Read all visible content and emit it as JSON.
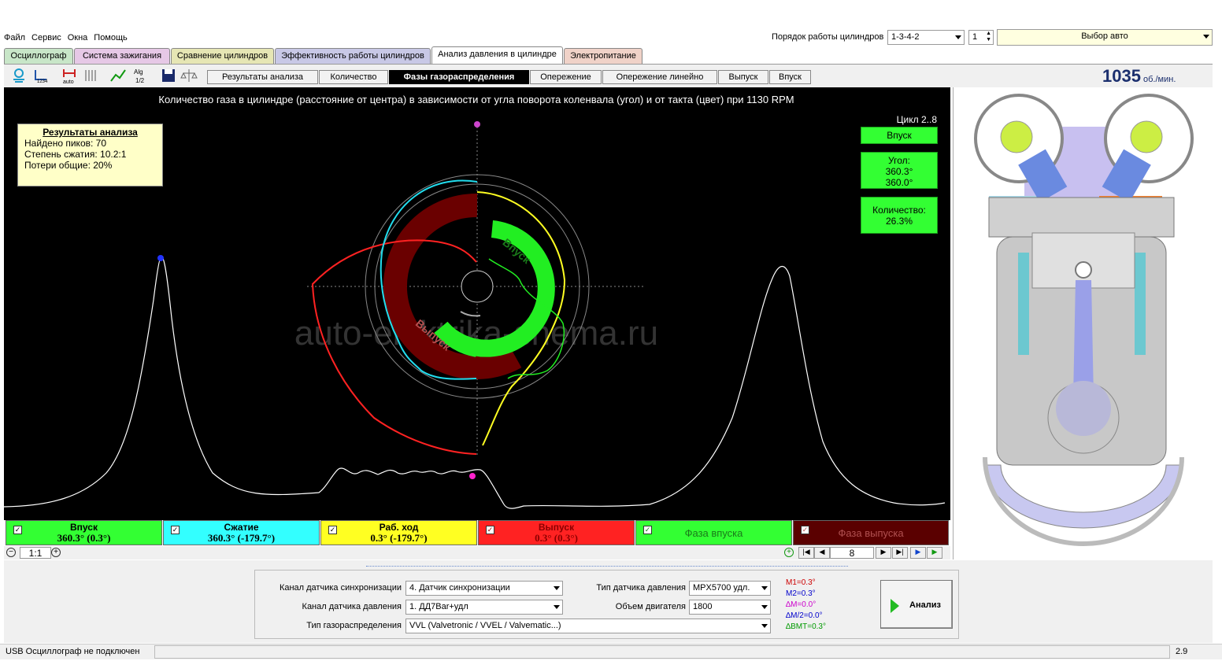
{
  "menu": [
    "Файл",
    "Сервис",
    "Окна",
    "Помощь"
  ],
  "cyl_order": {
    "label": "Порядок работы цилиндров",
    "value": "1-3-4-2",
    "cyl": "1",
    "car": "Выбор авто"
  },
  "tabs": [
    "Осциллограф",
    "Система зажигания",
    "Сравнение цилиндров",
    "Эффективность работы цилиндров",
    "Анализ давления в цилиндре",
    "Электропитание"
  ],
  "tab_colors": [
    "#c8e6c8",
    "#e6c8e6",
    "#e6e6b4",
    "#c8c8e6",
    "#ffffff",
    "#f0d2c8"
  ],
  "subtabs": [
    "Результаты анализа",
    "Количество",
    "Фазы газораспределения",
    "Опережение",
    "Опережение линейно",
    "Выпуск",
    "Впуск"
  ],
  "rpm": {
    "value": "1035",
    "unit": "об./мин."
  },
  "plot": {
    "title": "Количество газа в цилиндре (расстояние от центра) в зависимости от угла поворота коленвала (угол) и от такта (цвет) при 1130 RPM",
    "watermark": "auto-elektrika-shema.ru",
    "cycle": "Цикл 2..8",
    "phase_label": "Впуск",
    "angle_title": "Угол:",
    "angle1": "360.3°",
    "angle2": "360.0°",
    "qty_title": "Количество:",
    "qty_value": "26.3%",
    "ring_in": "Впуск",
    "ring_out": "Выпуск"
  },
  "results": {
    "title": "Результаты анализа",
    "peaks": "Найдено пиков: 70",
    "compression": "Степень сжатия: 10.2:1",
    "losses": "Потери общие: 20%"
  },
  "legend": [
    {
      "name": "Впуск",
      "value": "360.3° (0.3°)",
      "color": "#33ff33",
      "text": "#000000"
    },
    {
      "name": "Сжатие",
      "value": "360.3° (-179.7°)",
      "color": "#33ffff",
      "text": "#000000"
    },
    {
      "name": "Раб. ход",
      "value": "0.3° (-179.7°)",
      "color": "#ffff22",
      "text": "#000000"
    },
    {
      "name": "Выпуск",
      "value": "0.3° (0.3°)",
      "color": "#ff2222",
      "text": "#8b0000"
    },
    {
      "name": "Фаза впуска",
      "value": "",
      "color": "#33ff33",
      "text": "#1a7a1a"
    },
    {
      "name": "Фаза выпуска",
      "value": "",
      "color": "#5a0000",
      "text": "#b05050"
    }
  ],
  "nav": {
    "zoom": "1:1",
    "page": "8"
  },
  "settings": {
    "sync_label": "Канал датчика синхронизации",
    "sync_value": "4.  Датчик синхронизации",
    "press_label": "Канал датчика давления",
    "press_value": "1.  ДД7Bar+удл",
    "timing_label": "Тип газораспределения",
    "timing_value": "VVL (Valvetronic / VVEL / Valvematic...)",
    "sensor_label": "Тип датчика давления",
    "sensor_value": "MPX5700 удл.",
    "volume_label": "Объем двигателя",
    "volume_value": "1800"
  },
  "markers": [
    {
      "text": "M1=0.3°",
      "color": "#cc0000"
    },
    {
      "text": "M2=0.3°",
      "color": "#0000cc"
    },
    {
      "text": "∆M=0.0°",
      "color": "#cc00cc"
    },
    {
      "text": "∆M/2=0.0°",
      "color": "#0000cc"
    },
    {
      "text": "∆BMT=0.3°",
      "color": "#009900"
    }
  ],
  "analyze_label": "Анализ",
  "status": {
    "left": "USB Осциллограф не подключен",
    "right": "2.9"
  }
}
